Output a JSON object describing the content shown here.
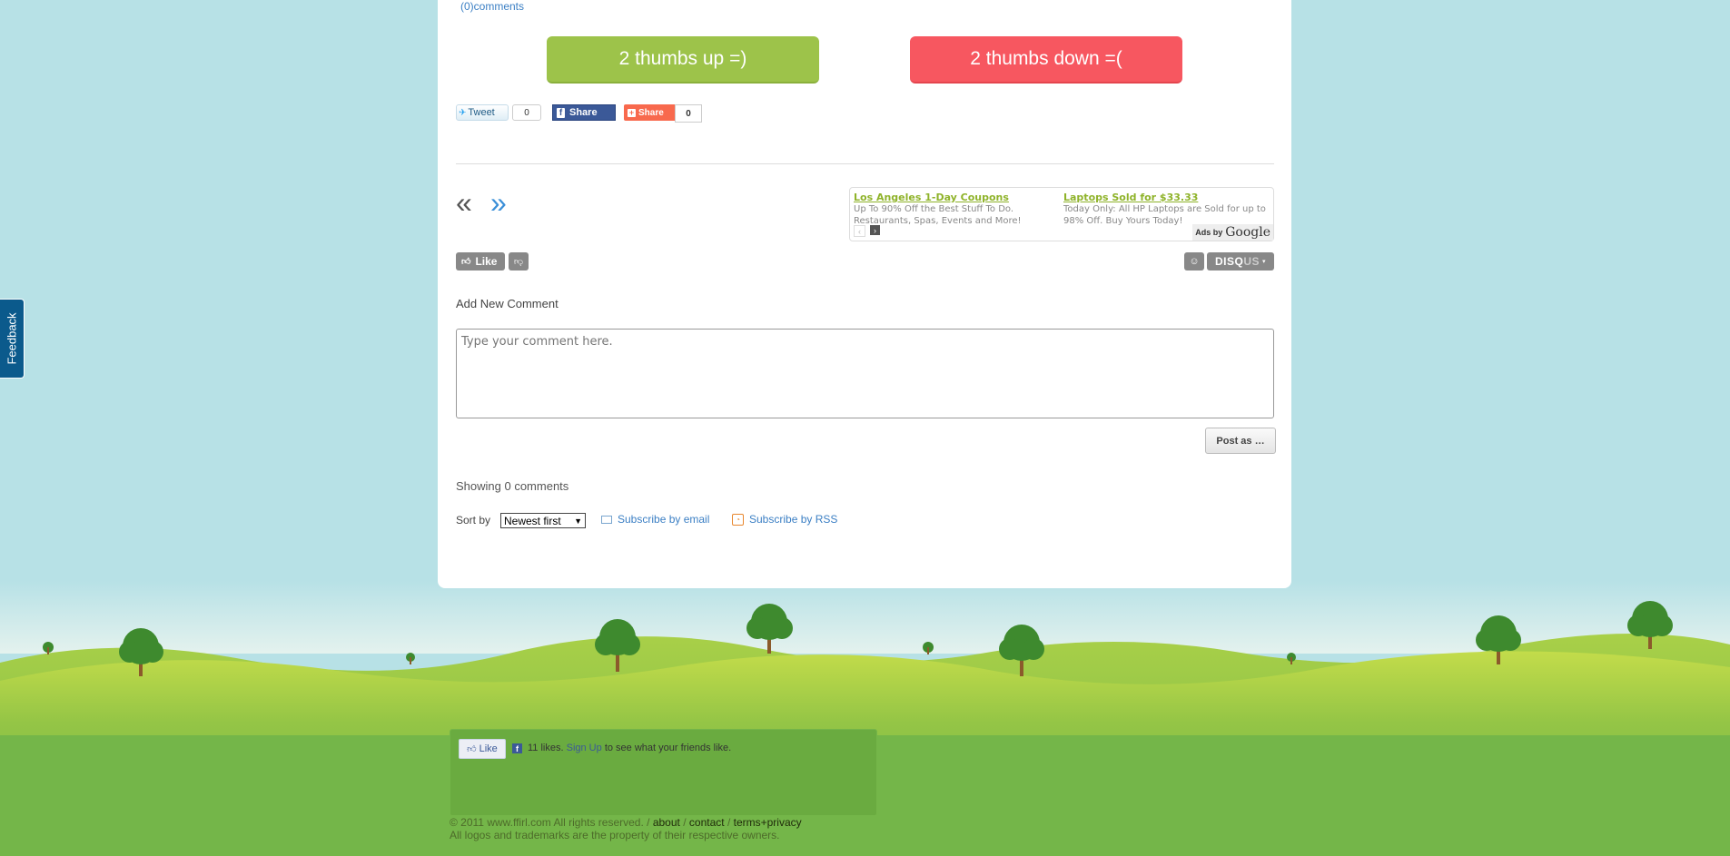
{
  "post": {
    "comments_link": "(0)comments",
    "vote_up_label": "2 thumbs up =)",
    "vote_down_label": "2 thumbs down =("
  },
  "share": {
    "tweet_label": "Tweet",
    "tweet_count": "0",
    "facebook_share_label": "Share",
    "addthis_label": "Share",
    "addthis_count": "0"
  },
  "navigation": {
    "prev_symbol": "«",
    "next_symbol": "»"
  },
  "ads": {
    "items": [
      {
        "title": "Los Angeles 1-Day Coupons",
        "text": "Up To 90% Off the Best Stuff To Do. Restaurants, Spas, Events and More!"
      },
      {
        "title": "Laptops Sold for $33.33",
        "text": "Today Only: All HP Laptops are Sold for up to 98% Off. Buy Yours Today!"
      }
    ],
    "ads_by_label": "Ads by",
    "ads_by_brand": "Google"
  },
  "disqus": {
    "like_label": "Like",
    "brand_main": "DISQ",
    "brand_suffix": "US",
    "add_comment_label": "Add New Comment",
    "comment_placeholder": "Type your comment here.",
    "post_button_label": "Post as …",
    "showing_label": "Showing 0 comments",
    "sort_label": "Sort by",
    "sort_value": "Newest first",
    "subscribe_email_label": "Subscribe by email",
    "subscribe_rss_label": "Subscribe by RSS"
  },
  "feedback_tab_label": "Feedback",
  "footer": {
    "fb_like_label": "Like",
    "fb_likes_text": "11 likes.",
    "fb_signup_label": "Sign Up",
    "fb_signup_suffix": "to see what your friends like.",
    "copyright": "© 2011 www.ffirl.com All rights reserved. /",
    "about_label": "about",
    "separator_1": "/",
    "contact_label": "contact",
    "separator_2": "/",
    "terms_label": "terms+privacy",
    "trademark_notice": "All logos and trademarks are the property of their respective owners."
  },
  "colors": {
    "background": "#b7e1e6",
    "vote_up": "#9dc34a",
    "vote_down": "#f75760",
    "feedback_tab": "#0b5a8c",
    "link_blue": "#3b7fc4",
    "grass_light": "#b5d64c",
    "grass_dark": "#6aab40"
  },
  "icons": {
    "tweet": "twitter-bird-icon",
    "facebook": "facebook-f-icon",
    "addthis": "plus-icon",
    "like": "thumbs-up-icon",
    "dislike": "thumbs-down-icon",
    "user": "user-icon",
    "email": "envelope-icon",
    "rss": "rss-icon"
  }
}
